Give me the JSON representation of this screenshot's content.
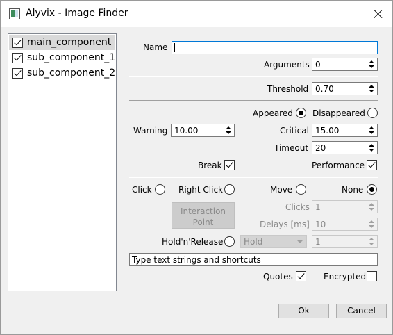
{
  "window": {
    "title": "Alyvix - Image Finder"
  },
  "components": [
    {
      "label": "main_component",
      "checked": true,
      "selected": true
    },
    {
      "label": "sub_component_1",
      "checked": true,
      "selected": false
    },
    {
      "label": "sub_component_2",
      "checked": true,
      "selected": false
    }
  ],
  "form": {
    "name_label": "Name",
    "name_value": "",
    "arguments_label": "Arguments",
    "arguments_value": "0",
    "threshold_label": "Threshold",
    "threshold_value": "0.70",
    "appeared_label": "Appeared",
    "disappeared_label": "Disappeared",
    "appeared_checked": true,
    "warning_label": "Warning",
    "warning_value": "10.00",
    "critical_label": "Critical",
    "critical_value": "15.00",
    "timeout_label": "Timeout",
    "timeout_value": "20",
    "break_label": "Break",
    "break_checked": true,
    "performance_label": "Performance",
    "performance_checked": true
  },
  "interaction": {
    "click_label": "Click",
    "right_click_label": "Right Click",
    "move_label": "Move",
    "none_label": "None",
    "selected": "None",
    "interaction_point_label": "Interaction\nPoint",
    "clicks_label": "Clicks",
    "clicks_value": "1",
    "delays_label": "Delays [ms]",
    "delays_value": "10",
    "hold_release_label": "Hold'n'Release",
    "hold_combo_value": "Hold",
    "hold_spin_value": "1",
    "text_value": "Type text strings and shortcuts",
    "quotes_label": "Quotes",
    "quotes_checked": true,
    "encrypted_label": "Encrypted",
    "encrypted_checked": false
  },
  "buttons": {
    "ok": "Ok",
    "cancel": "Cancel"
  }
}
